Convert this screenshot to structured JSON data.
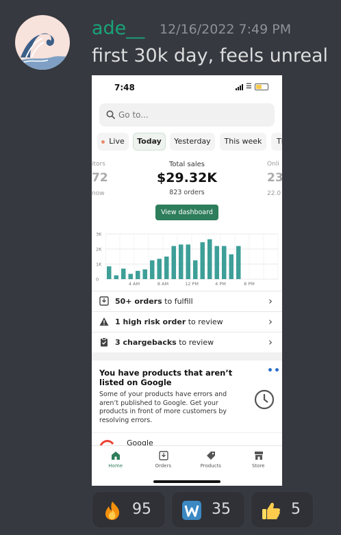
{
  "message": {
    "author": "ade__",
    "timestamp": "12/16/2022 7:49 PM",
    "text": "first 30k day, feels unreal"
  },
  "colors": {
    "background": "#36393f",
    "author": "#1aa37a",
    "brand_green": "#2e7d5b",
    "bar_teal": "#3d9f98"
  },
  "screenshot": {
    "status_time": "7:48",
    "search_placeholder": "Go to...",
    "chips": [
      "Live",
      "Today",
      "Yesterday",
      "This week",
      "Th"
    ],
    "active_chip": "Today",
    "metrics": {
      "left_label": "itors",
      "left_value": "72",
      "left_sub": "now",
      "center_label": "Total sales",
      "center_value": "$29.32K",
      "center_sub": "823 orders",
      "right_label": "Onli",
      "right_value": "23",
      "right_sub": "22.0"
    },
    "dashboard_button": "View dashboard",
    "tasks": [
      {
        "bold": "50+ orders",
        "rest": " to fulfill",
        "icon": "inbox-icon"
      },
      {
        "bold": "1 high risk order",
        "rest": " to review",
        "icon": "warning-icon"
      },
      {
        "bold": "3 chargebacks",
        "rest": " to review",
        "icon": "clipboard-icon"
      }
    ],
    "card": {
      "title": "You have products that aren’t listed on Google",
      "more": "•••",
      "body": "Some of your products have errors and aren’t published to Google. Get your products in front of more customers by resolving errors.",
      "app_name": "Google"
    },
    "tabs": [
      "Home",
      "Orders",
      "Products",
      "Store"
    ],
    "active_tab": "Home"
  },
  "chart_data": {
    "type": "bar",
    "y_ticks": [
      "3K",
      "2K",
      "1K",
      "0"
    ],
    "x_ticks": [
      "4 AM",
      "8 AM",
      "12 PM",
      "4 PM",
      "8 PM"
    ],
    "ylim": [
      0,
      3000
    ],
    "x": [
      0.5,
      1.5,
      2.5,
      3.5,
      4.5,
      5.5,
      6.5,
      7.5,
      8.5,
      9.5,
      10.5,
      11.5,
      12.5,
      13.5,
      14.5,
      15.5,
      16.5,
      17.5,
      18.5,
      19.5
    ],
    "values": [
      850,
      250,
      700,
      350,
      550,
      650,
      1250,
      1350,
      1500,
      2200,
      2300,
      2300,
      1250,
      2450,
      2650,
      2200,
      2200,
      1650,
      2200,
      0
    ],
    "xlim": [
      0,
      24
    ],
    "x_tick_positions": [
      4,
      8,
      12,
      16,
      20
    ],
    "grid": true
  },
  "reactions": [
    {
      "emoji": "fire-emoji",
      "count": "95"
    },
    {
      "emoji": "w-letter-emoji",
      "count": "35"
    },
    {
      "emoji": "thumbs-up-emoji",
      "count": "5"
    }
  ]
}
